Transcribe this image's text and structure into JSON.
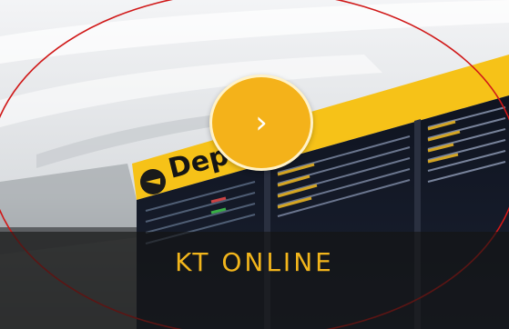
{
  "card": {
    "title": "KT ONLINE",
    "sign_text": "Dep",
    "action_icon": "chevron-right-icon",
    "accent_color": "#f4b21a",
    "caption_color": "#f2b51c"
  }
}
